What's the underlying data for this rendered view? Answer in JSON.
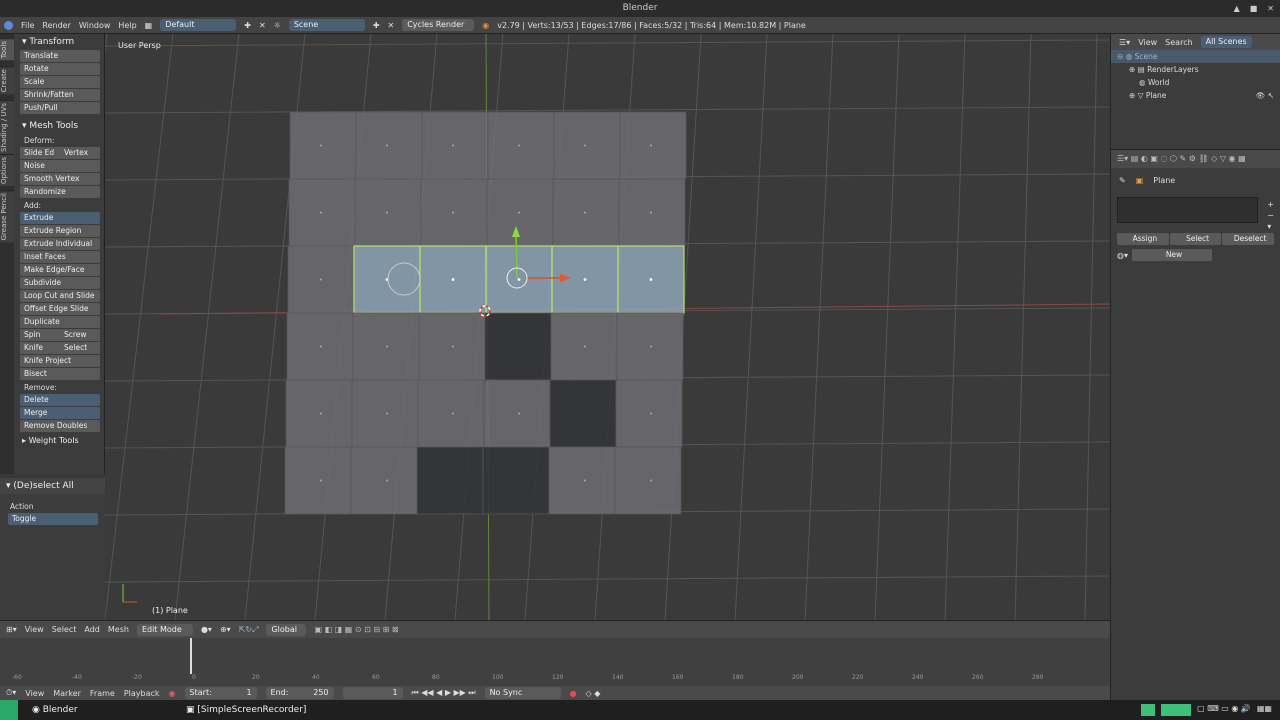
{
  "window": {
    "title": "Blender"
  },
  "info_bar": {
    "menus": [
      "File",
      "Render",
      "Window",
      "Help"
    ],
    "layout": "Default",
    "scene": "Scene",
    "engine": "Cycles Render",
    "stats": "v2.79 | Verts:13/53 | Edges:17/86 | Faces:5/32 | Tris:64 | Mem:10.82M | Plane"
  },
  "tool_tabs": [
    "Tools",
    "Create",
    "Shading / UVs",
    "Options",
    "Grease Pencil"
  ],
  "toolshelf": {
    "transform": {
      "title": "Transform",
      "items": [
        "Translate",
        "Rotate",
        "Scale",
        "Shrink/Fatten",
        "Push/Pull"
      ]
    },
    "mesh_tools": {
      "title": "Mesh Tools",
      "deform_label": "Deform:",
      "slide_edge": "Slide Ed",
      "vertex": "Vertex",
      "noise": "Noise",
      "smooth_vertex": "Smooth Vertex",
      "randomize": "Randomize",
      "add_label": "Add:",
      "extrude": "Extrude",
      "add_items": [
        "Extrude Region",
        "Extrude Individual",
        "Inset Faces",
        "Make Edge/Face",
        "Subdivide",
        "Loop Cut and Slide",
        "Offset Edge Slide",
        "Duplicate"
      ],
      "spin": "Spin",
      "screw": "Screw",
      "knife": "Knife",
      "select": "Select",
      "knife_project": "Knife Project",
      "bisect": "Bisect",
      "remove_label": "Remove:",
      "delete": "Delete",
      "merge": "Merge",
      "remove_doubles": "Remove Doubles"
    },
    "weight_tools": "Weight Tools"
  },
  "operator": {
    "title": "(De)select All",
    "action_label": "Action",
    "action_value": "Toggle"
  },
  "viewport": {
    "view_label": "User Persp",
    "object_label": "(1) Plane"
  },
  "v3d_header": {
    "menus": [
      "View",
      "Select",
      "Add",
      "Mesh"
    ],
    "mode": "Edit Mode",
    "orientation": "Global"
  },
  "timeline": {
    "ticks": [
      "-60",
      "-40",
      "-20",
      "0",
      "20",
      "40",
      "60",
      "80",
      "100",
      "120",
      "140",
      "160",
      "180",
      "200",
      "220",
      "240",
      "260",
      "280"
    ],
    "menus": [
      "View",
      "Marker",
      "Frame",
      "Playback"
    ],
    "start_label": "Start:",
    "start": "1",
    "end_label": "End:",
    "end": "250",
    "current": "1",
    "sync": "No Sync"
  },
  "outliner": {
    "menus": [
      "View",
      "Search"
    ],
    "filter": "All Scenes",
    "rows": [
      "Scene",
      "RenderLayers",
      "World",
      "Plane"
    ]
  },
  "properties": {
    "object_name": "Plane",
    "assign": "Assign",
    "select": "Select",
    "deselect": "Deselect",
    "new": "New"
  },
  "taskbar": {
    "items": [
      "Blender",
      "[SimpleScreenRecorder]"
    ]
  },
  "colors": {
    "selected_face": "#8fa6b8",
    "face": "#6e6e73",
    "accent": "#4a5f74"
  }
}
